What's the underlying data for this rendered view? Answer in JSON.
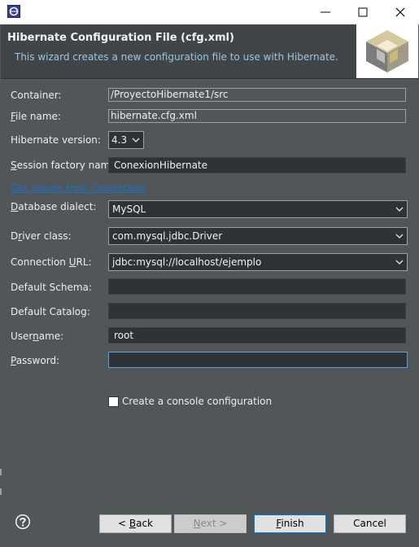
{
  "window": {
    "controls": [
      "minimize-icon",
      "maximize-icon",
      "close-icon"
    ]
  },
  "banner": {
    "title": "Hibernate Configuration File (cfg.xml)",
    "description": "This wizard creates a new configuration file to use with Hibernate."
  },
  "form": {
    "container": {
      "label": "Container:",
      "value": "/ProyectoHibernate1/src"
    },
    "file_name": {
      "label_u": "F",
      "label_rest": "ile name:",
      "value": "hibernate.cfg.xml"
    },
    "hibernate_version": {
      "label": "Hibernate version:",
      "value": "4.3"
    },
    "session_factory": {
      "label_u": "S",
      "label_rest": "ession factory name:",
      "value": "ConexionHibernate"
    },
    "get_values_link": "Get values from Connection",
    "dialect": {
      "label_u": "D",
      "label_rest": "atabase dialect:",
      "value": "MySQL"
    },
    "driver": {
      "label_pre": "D",
      "label_u": "r",
      "label_rest": "iver class:",
      "value": "com.mysql.jdbc.Driver"
    },
    "url": {
      "label_pre": "Connection ",
      "label_u": "U",
      "label_rest": "RL:",
      "value": "jdbc:mysql://localhost/ejemplo"
    },
    "schema": {
      "label": "Default Schema:",
      "value": ""
    },
    "catalog": {
      "label": "Default Catalog:",
      "value": ""
    },
    "username": {
      "label_pre": "User",
      "label_u": "n",
      "label_rest": "ame:",
      "value": "root"
    },
    "password": {
      "label_u": "P",
      "label_rest": "assword:",
      "value": ""
    },
    "console_config": {
      "label": "Create a console configuration",
      "checked": false
    }
  },
  "buttons": {
    "back_pre": "< ",
    "back_u": "B",
    "back_rest": "ack",
    "next_u": "N",
    "next_rest": "ext >",
    "finish_u": "F",
    "finish_rest": "inish",
    "cancel": "Cancel"
  },
  "colors": {
    "background": "#515658",
    "banner": "#404547",
    "link": "#1a70c8",
    "focus_border": "#5aa0dc"
  }
}
